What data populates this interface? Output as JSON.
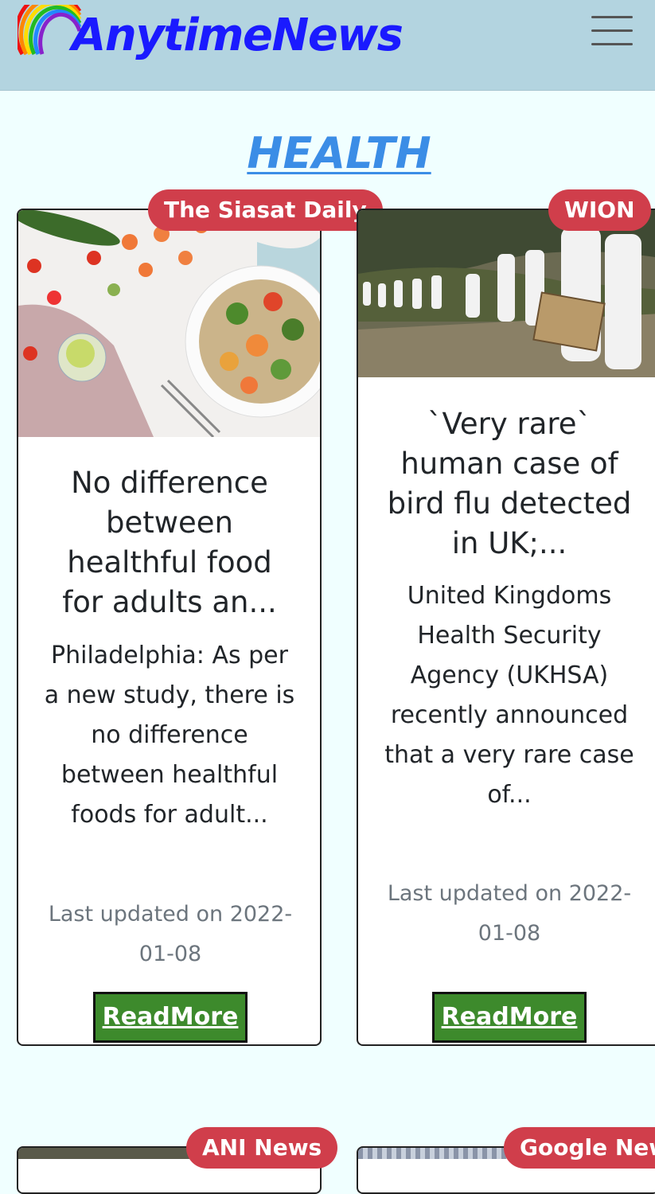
{
  "header": {
    "brand": "AnytimeNews",
    "logo_icon": "rainbow-icon",
    "menu_icon": "hamburger-menu-icon"
  },
  "section": {
    "title": "HEALTH"
  },
  "cards": [
    {
      "source": "The Siasat Daily",
      "title": "No difference between healthful food for adults an...",
      "description": "Philadelphia: As per a new study, there is no difference between healthful foods for adult...",
      "updated": "Last updated on 2022-01-08",
      "button": "ReadMore"
    },
    {
      "source": "WION",
      "title": "`Very rare` human case of bird flu detected in UK;...",
      "description": "United Kingdoms Health Security Agency (UKHSA) recently announced that a very rare case of...",
      "updated": "Last updated on 2022-01-08",
      "button": "ReadMore"
    },
    {
      "source": "ANI News"
    },
    {
      "source": "Google New"
    }
  ],
  "colors": {
    "navbar": "#b3d4e0",
    "brand": "#1a1aff",
    "section_title": "#3b8de6",
    "badge": "#d03e4b",
    "button": "#3d8a2c",
    "page_bg": "#f0ffff"
  }
}
